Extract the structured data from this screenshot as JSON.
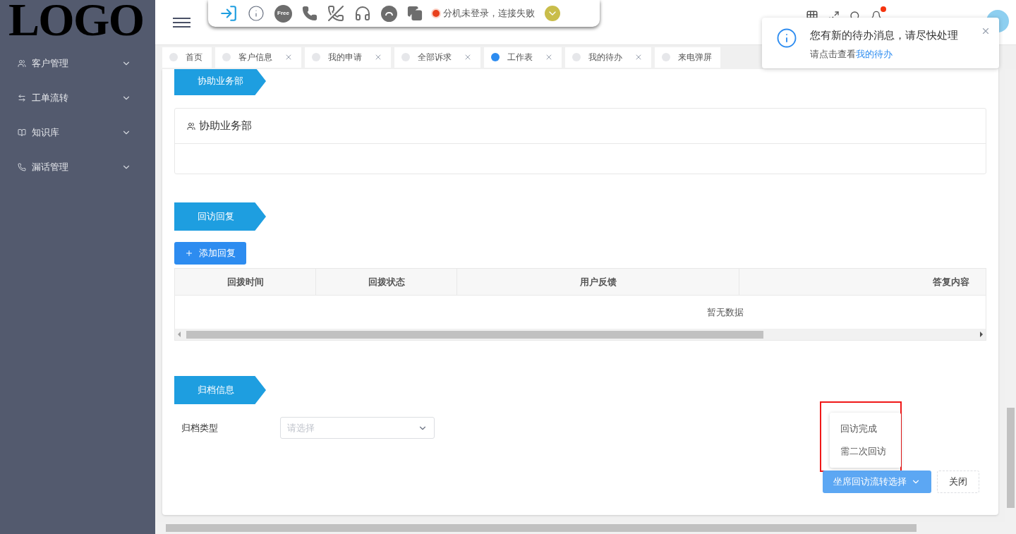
{
  "logo": "LOGO",
  "sidebar": {
    "items": [
      {
        "label": "客户管理",
        "kind": "users"
      },
      {
        "label": "工单流转",
        "kind": "transfer"
      },
      {
        "label": "知识库",
        "kind": "book"
      },
      {
        "label": "漏话管理",
        "kind": "phone"
      }
    ]
  },
  "toolbar": {
    "status": "分机未登录，连接失败",
    "free_label": "Free"
  },
  "tabs": [
    {
      "label": "首页",
      "selected": false,
      "closable": false
    },
    {
      "label": "客户信息",
      "selected": false,
      "closable": true
    },
    {
      "label": "我的申请",
      "selected": false,
      "closable": true
    },
    {
      "label": "全部诉求",
      "selected": false,
      "closable": true
    },
    {
      "label": "工作表",
      "selected": true,
      "closable": true
    },
    {
      "label": "我的待办",
      "selected": false,
      "closable": true
    },
    {
      "label": "来电弹屏",
      "selected": false,
      "closable": false
    }
  ],
  "notification": {
    "title": "您有新的待办消息，请尽快处理",
    "text": "请点击查看",
    "link": "我的待办"
  },
  "sections": [
    {
      "tag": "协助业务部",
      "panel_title": "协助业务部"
    },
    {
      "tag": "回访回复",
      "add_button": "添加回复",
      "columns": [
        "回拨时间",
        "回拨状态",
        "用户反馈",
        "答复内容"
      ],
      "empty_text": "暂无数据"
    },
    {
      "tag": "归档信息",
      "field_label": "归档类型",
      "placeholder": "请选择"
    }
  ],
  "dropdown": {
    "items": [
      "回访完成",
      "需二次回访"
    ]
  },
  "actions": {
    "primary": "坐席回访流转选择",
    "close": "关闭"
  }
}
